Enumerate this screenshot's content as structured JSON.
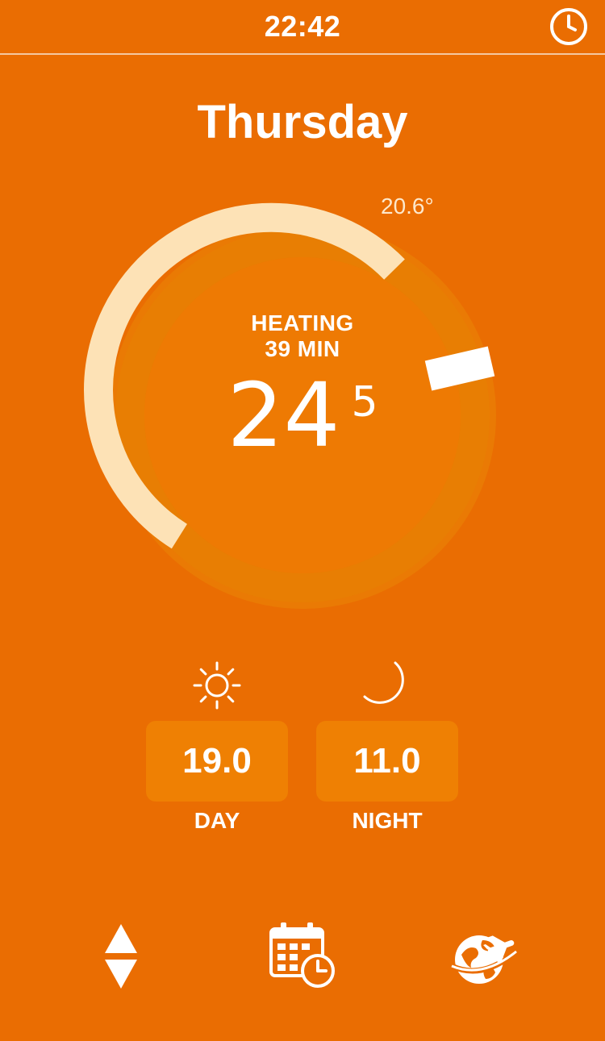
{
  "status_bar": {
    "time": "22:42",
    "clock_icon": "clock-icon"
  },
  "day": "Thursday",
  "thermostat": {
    "current_temperature": "20.6°",
    "mode": "HEATING",
    "duration": "39 MIN",
    "target_whole": "24",
    "target_fraction": "5",
    "colors": {
      "background": "#ea6d02",
      "arc_active": "#fde2b6",
      "arc_track": "#e87e03",
      "marker": "#ffffff"
    }
  },
  "presets": {
    "day": {
      "value": "19.0",
      "label": "DAY",
      "icon": "sun-icon"
    },
    "night": {
      "value": "11.0",
      "label": "NIGHT",
      "icon": "moon-icon"
    }
  },
  "bottom_nav": {
    "items": [
      {
        "icon": "up-down-arrows-icon"
      },
      {
        "icon": "calendar-clock-icon"
      },
      {
        "icon": "globe-plane-icon"
      }
    ]
  }
}
